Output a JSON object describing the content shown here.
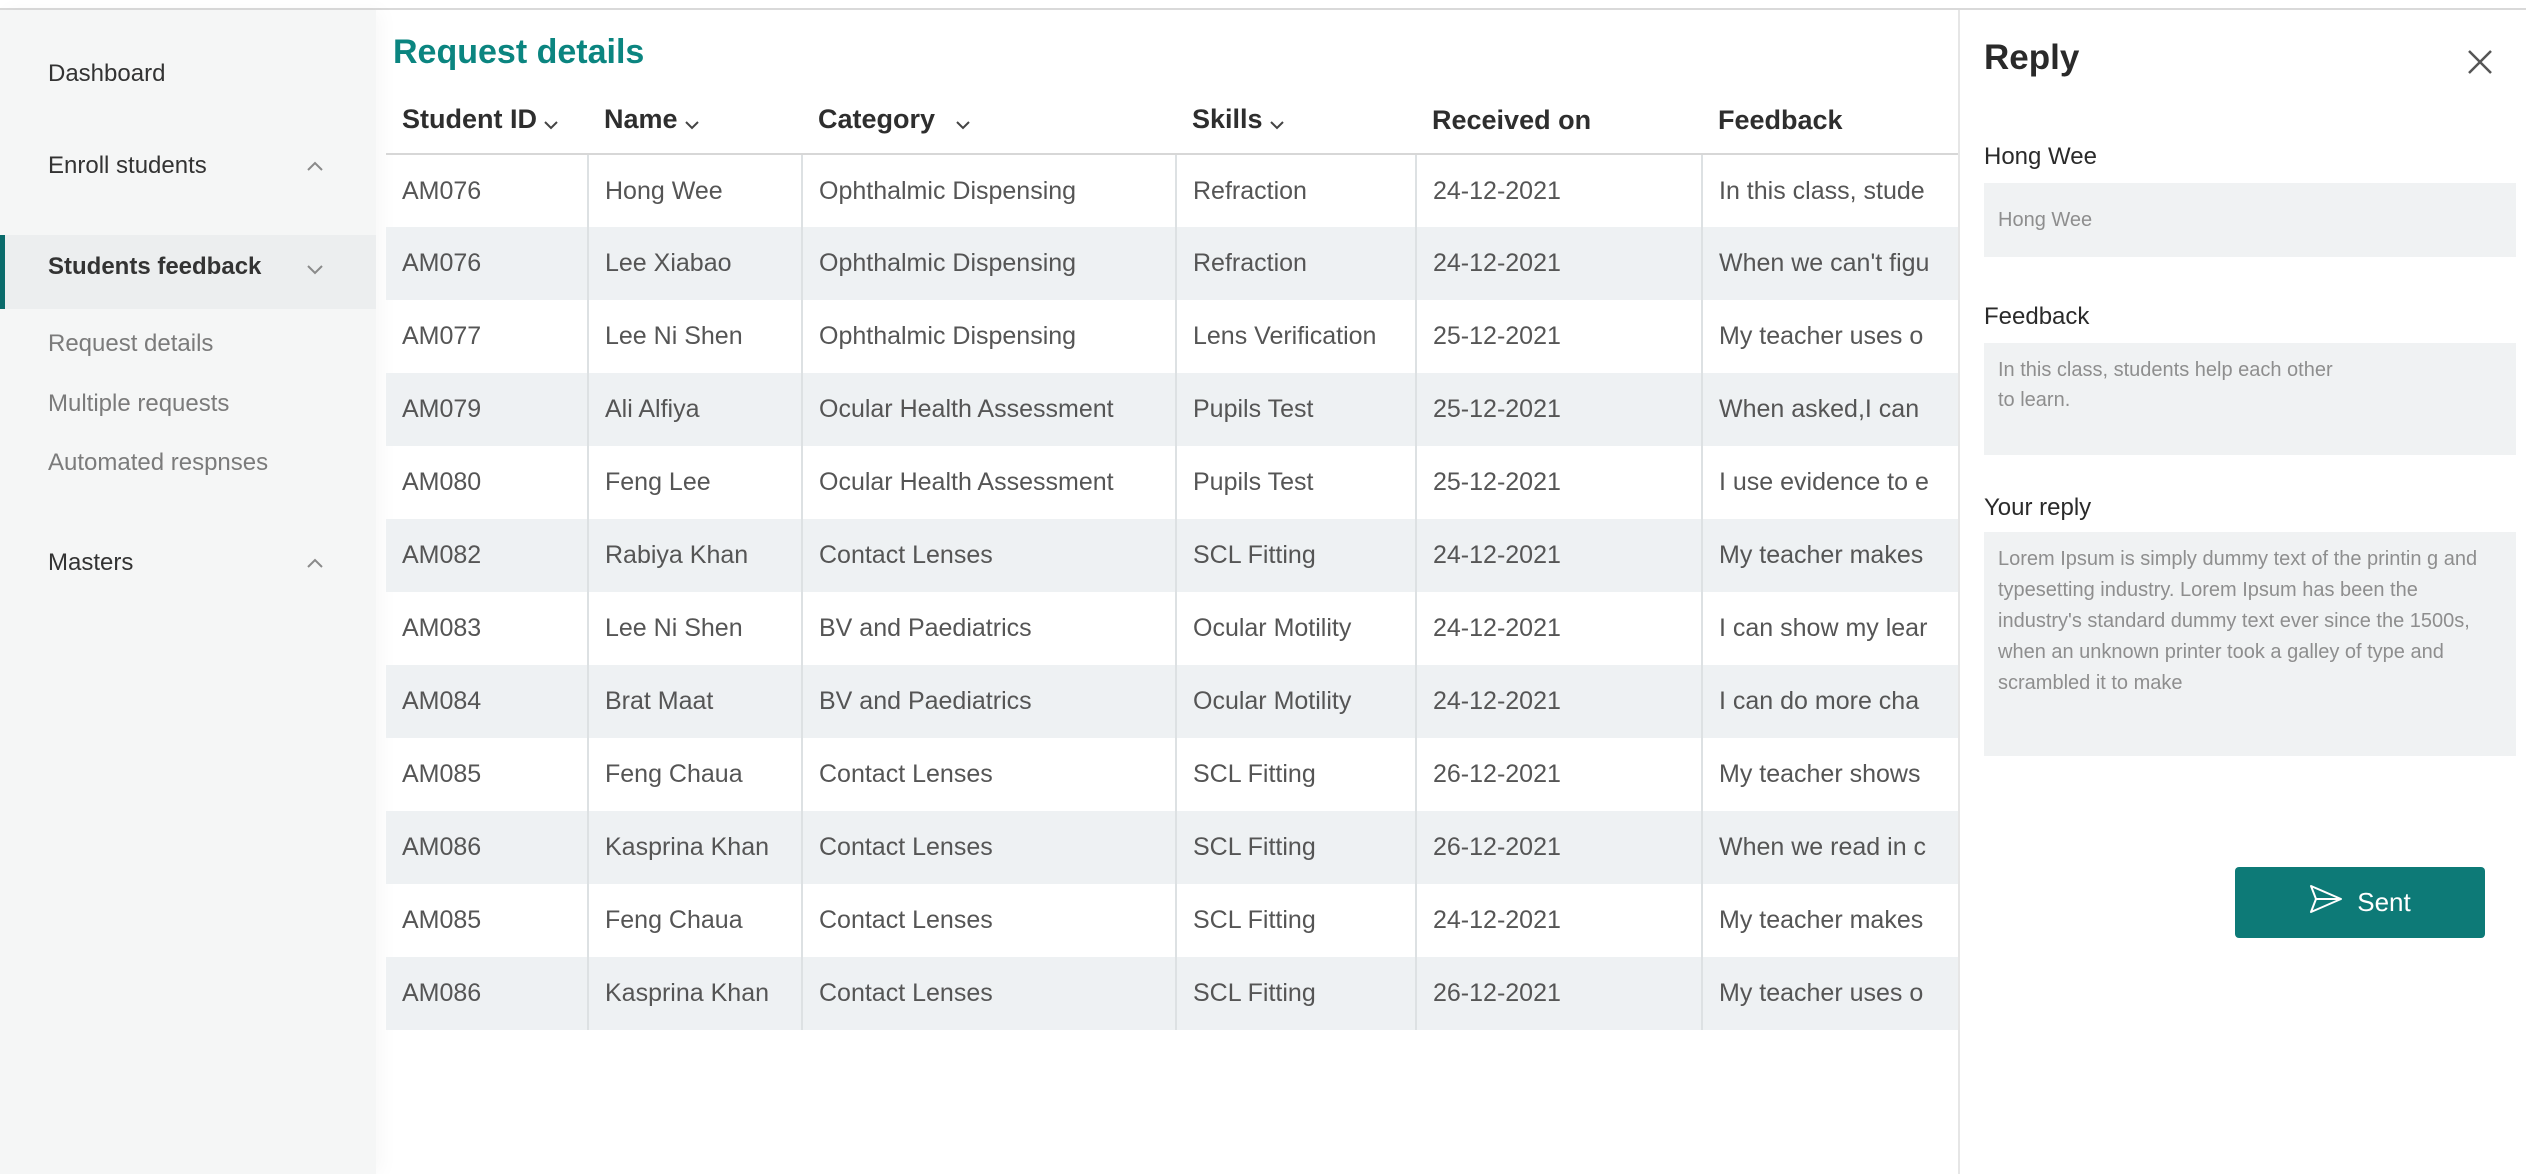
{
  "sidebar": {
    "items": [
      {
        "label": "Dashboard"
      },
      {
        "label": "Enroll students"
      },
      {
        "label": "Students feedback"
      },
      {
        "label": "Masters"
      }
    ],
    "subitems": [
      {
        "label": "Request details"
      },
      {
        "label": "Multiple requests"
      },
      {
        "label": "Automated respnses"
      }
    ]
  },
  "main": {
    "title": "Request details",
    "columns": [
      "Student ID",
      "Name",
      "Category",
      "Skills",
      "Received on",
      "Feedback"
    ],
    "rows": [
      [
        "AM076",
        "Hong Wee",
        "Ophthalmic Dispensing",
        "Refraction",
        "24-12-2021",
        "In this class, stude"
      ],
      [
        "AM076",
        "Lee Xiabao",
        "Ophthalmic Dispensing",
        "Refraction",
        "24-12-2021",
        "When we can't figu"
      ],
      [
        "AM077",
        "Lee Ni Shen",
        "Ophthalmic Dispensing",
        "Lens Verification",
        "25-12-2021",
        "My teacher uses o"
      ],
      [
        "AM079",
        "Ali Alfiya",
        "Ocular Health Assessment",
        "Pupils Test",
        "25-12-2021",
        "When asked,I can"
      ],
      [
        "AM080",
        "Feng Lee",
        "Ocular Health Assessment",
        "Pupils Test",
        "25-12-2021",
        "I use evidence to e"
      ],
      [
        "AM082",
        "Rabiya Khan",
        "Contact Lenses",
        "SCL Fitting",
        "24-12-2021",
        "My teacher makes"
      ],
      [
        "AM083",
        "Lee Ni Shen",
        "BV and Paediatrics",
        "Ocular Motility",
        "24-12-2021",
        "I can show my lear"
      ],
      [
        "AM084",
        "Brat Maat",
        "BV and Paediatrics",
        "Ocular Motility",
        "24-12-2021",
        "I can do more cha"
      ],
      [
        "AM085",
        "Feng Chaua",
        "Contact Lenses",
        "SCL Fitting",
        "26-12-2021",
        "My teacher shows"
      ],
      [
        "AM086",
        "Kasprina Khan",
        "Contact Lenses",
        "SCL Fitting",
        "26-12-2021",
        "When we read in c"
      ],
      [
        "AM085",
        "Feng Chaua",
        "Contact Lenses",
        "SCL Fitting",
        "24-12-2021",
        "My teacher makes"
      ],
      [
        "AM086",
        "Kasprina Khan",
        "Contact Lenses",
        "SCL Fitting",
        "26-12-2021",
        "My teacher uses o"
      ]
    ]
  },
  "panel": {
    "title": "Reply",
    "name_label": "Hong Wee",
    "name_value": "Hong Wee",
    "feedback_label": "Feedback",
    "feedback_value": "In this class, students help each other\nto learn.",
    "reply_label": "Your reply",
    "reply_value": "Lorem Ipsum is simply dummy text of the printin g and typesetting industry. Lorem Ipsum has been the industry's standard dummy text ever since the 1500s, when an unknown printer took a galley of type and scrambled it to make",
    "send_label": "Sent"
  },
  "icons": {
    "close": "close-icon",
    "send": "send-icon",
    "chevron_up": "chevron-up-icon",
    "chevron_down": "chevron-down-icon"
  },
  "colors": {
    "accent": "#0b8580",
    "button": "#0d7a77",
    "row_alt": "#eef1f3",
    "sidebar_bg": "#f5f6f6"
  }
}
